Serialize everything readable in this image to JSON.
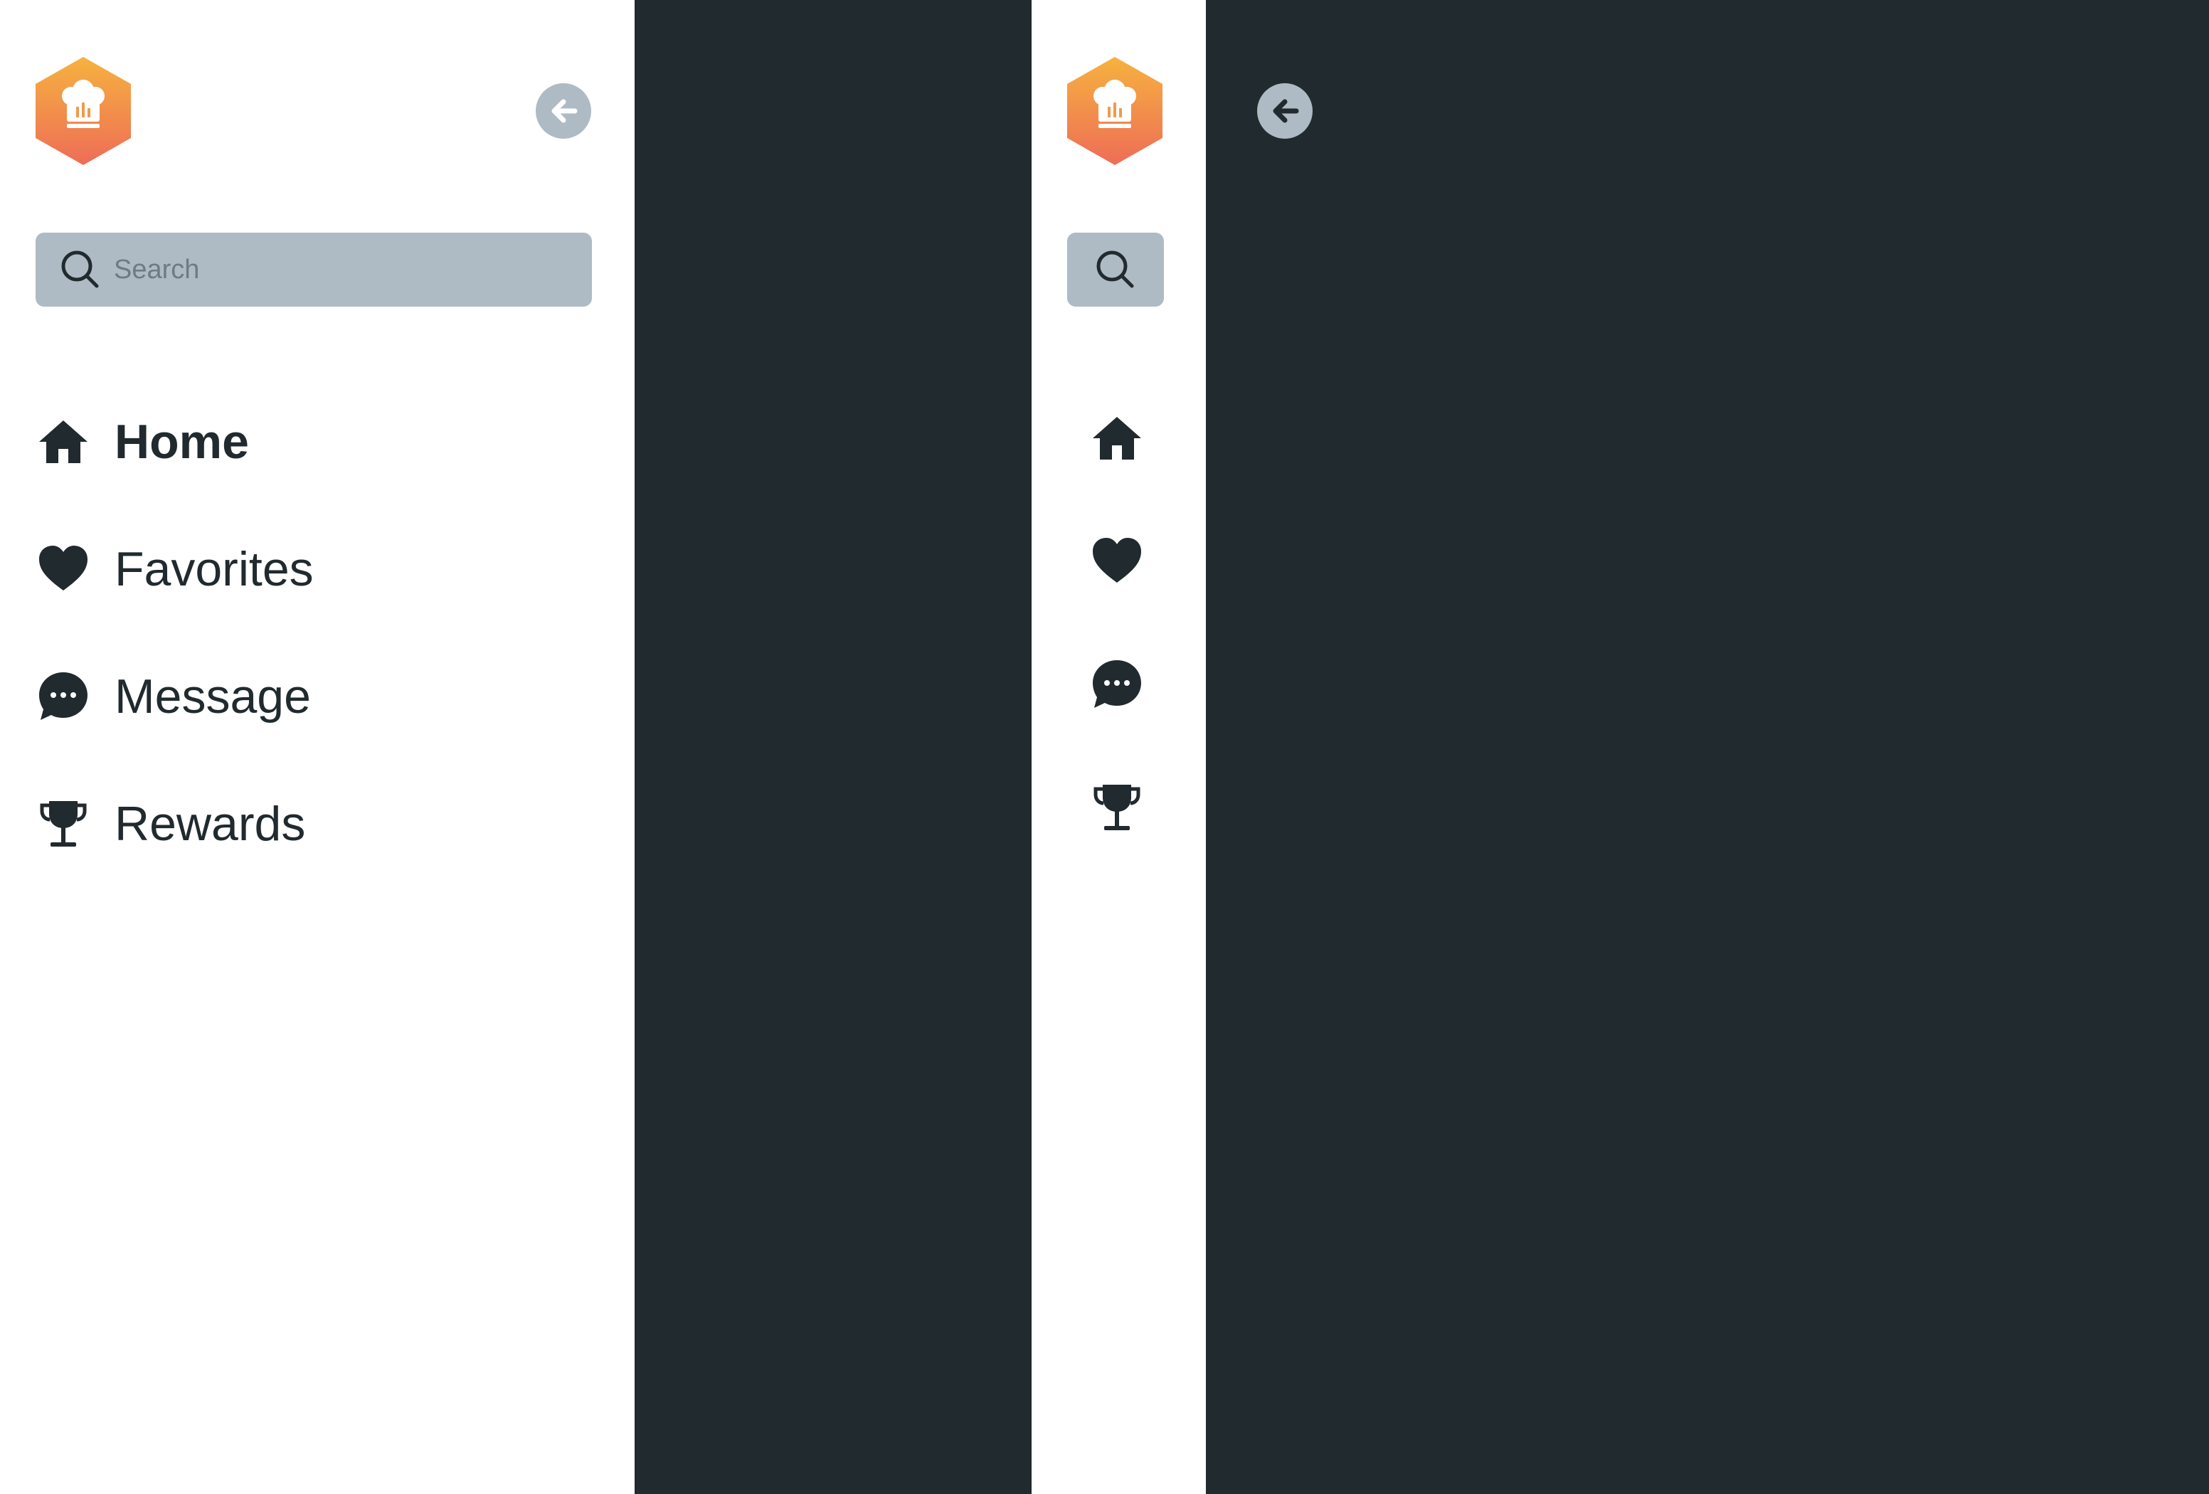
{
  "colors": {
    "background_dark": "#212a2e",
    "sidebar_bg": "#ffffff",
    "search_bg": "#aebbc4",
    "text_primary": "#212a2e",
    "logo_gradient_top": "#f6b23f",
    "logo_gradient_bottom": "#ee6d57"
  },
  "sidebar_expanded": {
    "logo_icon": "chef-hat-logo-icon",
    "collapse_toggle_icon": "arrow-left-icon",
    "search": {
      "icon": "search-icon",
      "placeholder": "Search",
      "value": ""
    },
    "nav": [
      {
        "label": "Home",
        "icon": "home-icon",
        "active": true
      },
      {
        "label": "Favorites",
        "icon": "heart-icon",
        "active": false
      },
      {
        "label": "Message",
        "icon": "chat-bubble-icon",
        "active": false
      },
      {
        "label": "Rewards",
        "icon": "trophy-icon",
        "active": false
      }
    ]
  },
  "sidebar_collapsed": {
    "logo_icon": "chef-hat-logo-icon",
    "expand_toggle_icon": "arrow-left-icon",
    "search_icon": "search-icon",
    "nav_icons": [
      "home-icon",
      "heart-icon",
      "chat-bubble-icon",
      "trophy-icon"
    ]
  }
}
